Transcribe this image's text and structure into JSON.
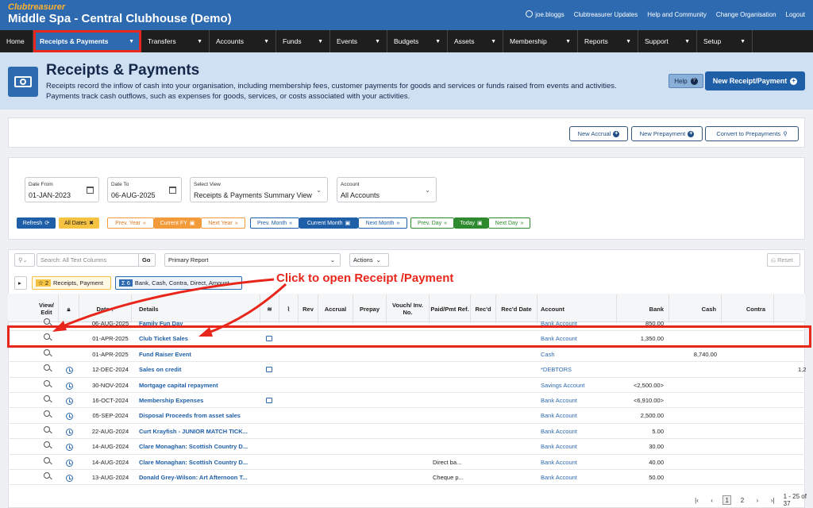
{
  "header": {
    "logo_text": "Clubtreasurer",
    "org_title": "Middle Spa - Central Clubhouse (Demo)",
    "links": [
      "joe.bloggs",
      "Clubtreasurer Updates",
      "Help and Community",
      "Change Organisation",
      "Logout"
    ]
  },
  "nav": [
    {
      "label": "Home",
      "chev": false
    },
    {
      "label": "Receipts & Payments",
      "chev": true
    },
    {
      "label": "Transfers",
      "chev": true
    },
    {
      "label": "Accounts",
      "chev": true
    },
    {
      "label": "Funds",
      "chev": true
    },
    {
      "label": "Events",
      "chev": true
    },
    {
      "label": "Budgets",
      "chev": true
    },
    {
      "label": "Assets",
      "chev": true
    },
    {
      "label": "Membership",
      "chev": true
    },
    {
      "label": "Reports",
      "chev": true
    },
    {
      "label": "Support",
      "chev": true
    },
    {
      "label": "Setup",
      "chev": true
    }
  ],
  "page": {
    "title": "Receipts & Payments",
    "desc1": "Receipts record the inflow of cash into your organisation, including membership fees, customer payments for goods and services or funds raised from events and activities.",
    "desc2": "Payments track cash outflows, such as expenses for goods, services, or costs associated with your activities.",
    "help_label": "Help",
    "new_button": "New Receipt/Payment"
  },
  "actions": {
    "new_accrual": "New Accrual",
    "new_prepayment": "New Prepayment",
    "convert": "Convert to Prepayments"
  },
  "filters": {
    "date_from_label": "Date From",
    "date_from": "01-JAN-2023",
    "date_to_label": "Date To",
    "date_to": "06-AUG-2025",
    "view_label": "Select View",
    "view_value": "Receipts & Payments Summary View",
    "account_label": "Account",
    "account_value": "All Accounts",
    "refresh": "Refresh",
    "all_dates": "All Dates",
    "prev_year": "Prev. Year",
    "current_fy": "Current FY",
    "next_year": "Next Year",
    "prev_month": "Prev. Month",
    "current_month": "Current Month",
    "next_month": "Next Month",
    "prev_day": "Prev. Day",
    "today": "Today",
    "next_day": "Next Day"
  },
  "toolbar": {
    "search_placeholder": "Search: All Text Columns",
    "go": "Go",
    "report": "Primary Report",
    "actions": "Actions",
    "reset": "Reset",
    "filter1_count": "2",
    "filter1_text": "Receipts, Payment",
    "filter2_count": "6",
    "filter2_text": "Bank, Cash, Contra, Direct, Amount"
  },
  "columns": {
    "view_edit": "View/ Edit",
    "date": "Date",
    "details": "Details",
    "rev": "Rev",
    "accrual": "Accrual",
    "prepay": "Prepay",
    "vouch": "Vouch/ Inv. No.",
    "paid": "Paid/Pmt Ref.",
    "recd": "Rec'd",
    "recd_date": "Rec'd Date",
    "account": "Account",
    "bank": "Bank",
    "cash": "Cash",
    "contra": "Contra"
  },
  "rows": [
    {
      "date": "06-AUG-2025",
      "details": "Family Fun Day",
      "account": "Bank Account",
      "bank": "850.00",
      "cash": "",
      "paid": "",
      "clock": false,
      "layer": false,
      "contra": ""
    },
    {
      "date": "01-APR-2025",
      "details": "Club Ticket Sales",
      "account": "Bank Account",
      "bank": "1,350.00",
      "cash": "",
      "paid": "",
      "clock": false,
      "layer": true,
      "contra": ""
    },
    {
      "date": "01-APR-2025",
      "details": "Fund Raiser Event",
      "account": "Cash",
      "bank": "",
      "cash": "8,740.00",
      "paid": "",
      "clock": false,
      "layer": false,
      "contra": ""
    },
    {
      "date": "12-DEC-2024",
      "details": "Sales on credit",
      "account": "*DEBTORS",
      "bank": "",
      "cash": "",
      "paid": "",
      "clock": true,
      "layer": true,
      "contra": "1,2"
    },
    {
      "date": "30-NOV-2024",
      "details": "Mortgage capital repayment",
      "account": "Savings Account",
      "bank": "<2,500.00>",
      "cash": "",
      "paid": "",
      "clock": true,
      "layer": false,
      "contra": ""
    },
    {
      "date": "16-OCT-2024",
      "details": "Membership Expenses",
      "account": "Bank Account",
      "bank": "<6,910.00>",
      "cash": "",
      "paid": "",
      "clock": true,
      "layer": true,
      "contra": ""
    },
    {
      "date": "05-SEP-2024",
      "details": "Disposal Proceeds from asset sales",
      "account": "Bank Account",
      "bank": "2,500.00",
      "cash": "",
      "paid": "",
      "clock": true,
      "layer": false,
      "contra": ""
    },
    {
      "date": "22-AUG-2024",
      "details": "Curt Krayfish - JUNIOR MATCH TICK...",
      "account": "Bank Account",
      "bank": "5.00",
      "cash": "",
      "paid": "",
      "clock": true,
      "layer": false,
      "contra": ""
    },
    {
      "date": "14-AUG-2024",
      "details": "Clare Monaghan: Scottish Country D...",
      "account": "Bank Account",
      "bank": "30.00",
      "cash": "",
      "paid": "",
      "clock": true,
      "layer": false,
      "contra": ""
    },
    {
      "date": "14-AUG-2024",
      "details": "Clare Monaghan: Scottish Country D...",
      "account": "Bank Account",
      "bank": "40.00",
      "cash": "",
      "paid": "Direct ba...",
      "clock": true,
      "layer": false,
      "contra": ""
    },
    {
      "date": "13-AUG-2024",
      "details": "Donald Grey-Wilson: Art Afternoon T...",
      "account": "Bank Account",
      "bank": "50.00",
      "cash": "",
      "paid": "Cheque p...",
      "clock": true,
      "layer": false,
      "contra": ""
    }
  ],
  "annotation": "Click to open Receipt /Payment",
  "pager": {
    "pages": [
      "1",
      "2"
    ],
    "range": "1 - 25 of 37"
  },
  "colors": {
    "primary": "#2d6ab0",
    "annotation": "#e8261b",
    "accent_yellow": "#f5c242"
  }
}
